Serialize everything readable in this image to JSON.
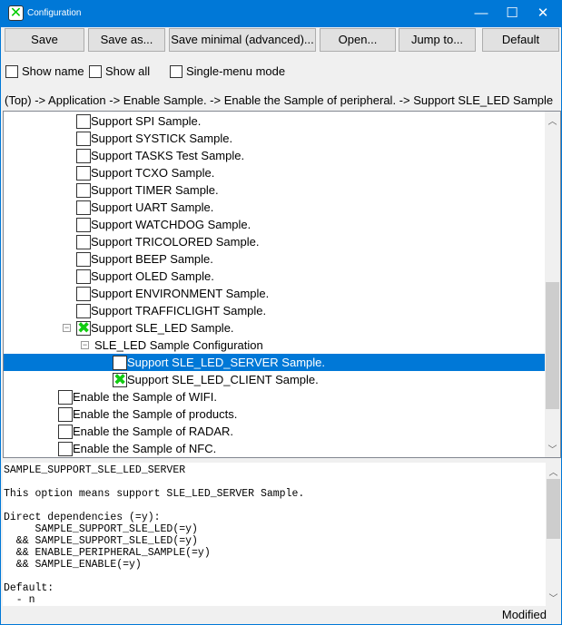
{
  "window": {
    "title": "Configuration",
    "minimize": "—",
    "maximize": "☐",
    "close": "✕"
  },
  "toolbar": {
    "buttons": [
      "Save",
      "Save as...",
      "Save minimal (advanced)...",
      "Open...",
      "Jump to...",
      "Default"
    ]
  },
  "options": {
    "show_name": {
      "label": "Show name",
      "checked": false
    },
    "show_all": {
      "label": "Show all",
      "checked": false
    },
    "single_menu": {
      "label": "Single-menu mode",
      "checked": false
    }
  },
  "breadcrumb": "(Top) -> Application -> Enable Sample. -> Enable the Sample of peripheral. -> Support SLE_LED Sample",
  "tree": {
    "rows": [
      {
        "label": "Support SPI Sample.",
        "checked": false
      },
      {
        "label": "Support SYSTICK Sample.",
        "checked": false
      },
      {
        "label": "Support TASKS Test Sample.",
        "checked": false
      },
      {
        "label": "Support TCXO Sample.",
        "checked": false
      },
      {
        "label": "Support TIMER Sample.",
        "checked": false
      },
      {
        "label": "Support UART Sample.",
        "checked": false
      },
      {
        "label": "Support WATCHDOG Sample.",
        "checked": false
      },
      {
        "label": "Support TRICOLORED Sample.",
        "checked": false
      },
      {
        "label": "Support BEEP Sample.",
        "checked": false
      },
      {
        "label": "Support OLED Sample.",
        "checked": false
      },
      {
        "label": "Support ENVIRONMENT Sample.",
        "checked": false
      },
      {
        "label": "Support TRAFFICLIGHT Sample.",
        "checked": false
      },
      {
        "label": "Support SLE_LED Sample.",
        "checked": true,
        "expanded": true
      },
      {
        "label": "SLE_LED Sample Configuration",
        "menu": true,
        "expanded": true
      },
      {
        "label": "Support SLE_LED_SERVER Sample.",
        "checked": false,
        "selected": true
      },
      {
        "label": "Support SLE_LED_CLIENT Sample.",
        "checked": true
      },
      {
        "label": "Enable the Sample of WIFI.",
        "checked": false
      },
      {
        "label": "Enable the Sample of products.",
        "checked": false
      },
      {
        "label": "Enable the Sample of RADAR.",
        "checked": false
      },
      {
        "label": "Enable the Sample of NFC.",
        "checked": false
      }
    ]
  },
  "info": {
    "text": "SAMPLE_SUPPORT_SLE_LED_SERVER\n\nThis option means support SLE_LED_SERVER Sample.\n\nDirect dependencies (=y):\n     SAMPLE_SUPPORT_SLE_LED(=y)\n  && SAMPLE_SUPPORT_SLE_LED(=y)\n  && ENABLE_PERIPHERAL_SAMPLE(=y)\n  && SAMPLE_ENABLE(=y)\n\nDefault:\n  - n"
  },
  "status": "Modified"
}
